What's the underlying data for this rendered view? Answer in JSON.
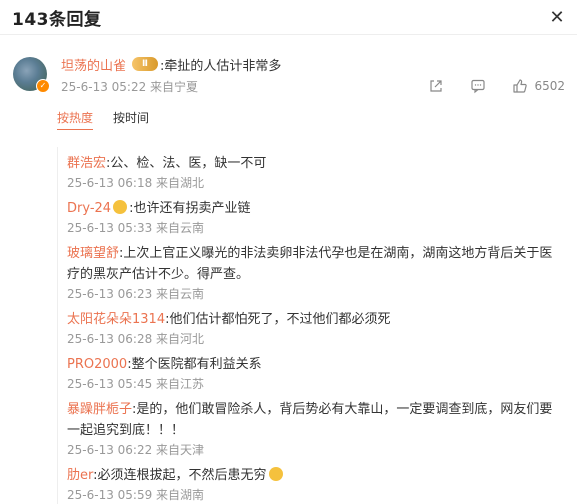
{
  "header": {
    "title": "143条回复",
    "close_glyph": "✕"
  },
  "main_comment": {
    "username": "坦荡的山雀",
    "vip_badge": "Ⅱ",
    "text": ":牵扯的人估计非常多",
    "meta": "25-6-13 05:22 来自宁夏",
    "like_count": "6502"
  },
  "sort": {
    "hot": "按热度",
    "time": "按时间"
  },
  "replies": [
    {
      "name": "群浩宏",
      "text": ":公、检、法、医，缺一不可",
      "meta": "25-6-13 06:18 来自湖北"
    },
    {
      "name": "Dry-24",
      "text": ":也许还有拐卖产业链",
      "meta": "25-6-13 05:33 来自云南"
    },
    {
      "name": "玻璃望舒",
      "text": ":上次上官正义曝光的非法卖卵非法代孕也是在湖南，湖南这地方背后关于医疗的黑灰产估计不少。得严查。",
      "meta": "25-6-13 06:23 来自云南"
    },
    {
      "name": "太阳花朵朵1314",
      "text": ":他们估计都怕死了，不过他们都必须死",
      "meta": "25-6-13 06:28 来自河北"
    },
    {
      "name": "PRO2000",
      "text": ":整个医院都有利益关系",
      "meta": "25-6-13 05:45 来自江苏"
    },
    {
      "name": "暴躁胖栀子",
      "text": ":是的，他们敢冒险杀人，背后势必有大靠山，一定要调查到底，网友们要一起追究到底！！！",
      "meta": "25-6-13 06:22 来自天津"
    },
    {
      "name": "肋er",
      "text": ":必须连根拔起，不然后患无穷",
      "meta": "25-6-13 05:59 来自湖南"
    }
  ],
  "colors": {
    "accent": "#eb7350",
    "meta": "#999999"
  }
}
